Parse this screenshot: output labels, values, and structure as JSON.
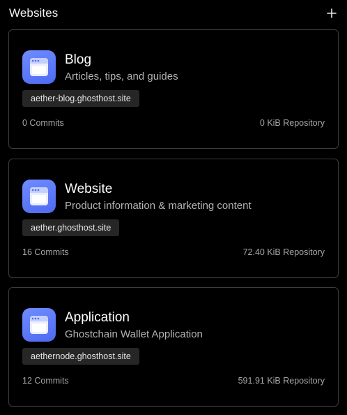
{
  "header": {
    "title": "Websites",
    "add_icon": "plus-icon"
  },
  "sites": [
    {
      "title": "Blog",
      "subtitle": "Articles, tips, and guides",
      "domain": "aether-blog.ghosthost.site",
      "commits": "0 Commits",
      "repository": "0 KiB Repository",
      "icon": "browser-window-icon"
    },
    {
      "title": "Website",
      "subtitle": "Product information & marketing content",
      "domain": "aether.ghosthost.site",
      "commits": "16 Commits",
      "repository": "72.40 KiB Repository",
      "icon": "browser-window-icon"
    },
    {
      "title": "Application",
      "subtitle": "Ghostchain Wallet Application",
      "domain": "aethernode.ghosthost.site",
      "commits": "12 Commits",
      "repository": "591.91 KiB Repository",
      "icon": "browser-window-icon"
    }
  ],
  "colors": {
    "background": "#000000",
    "card_border": "#3c3c3c",
    "icon_gradient_start": "#6f8cff",
    "icon_gradient_end": "#4f6af0",
    "pill_background": "#262626"
  }
}
